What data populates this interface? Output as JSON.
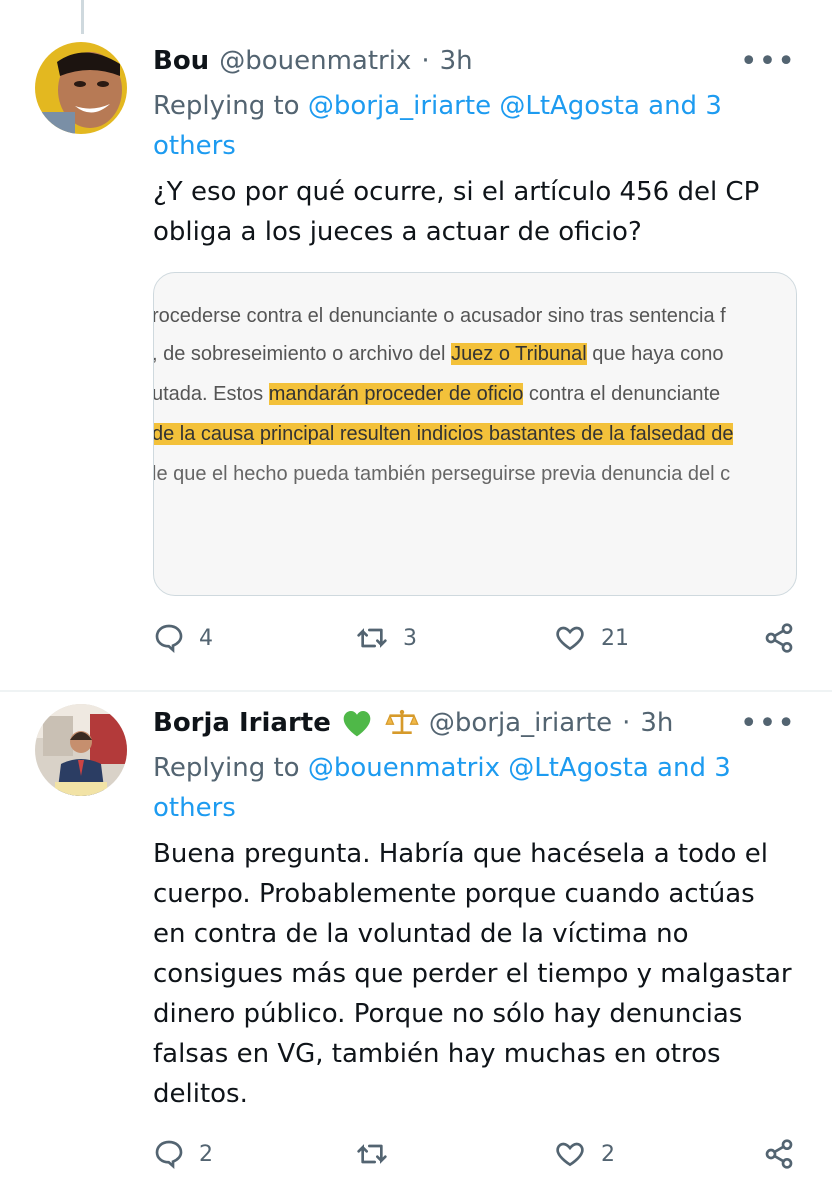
{
  "tweets": [
    {
      "name": "Bou",
      "handle": "@bouenmatrix",
      "time": "3h",
      "reply_prefix": "Replying to",
      "reply_mentions": "@borja_iriarte @LtAgosta and 3",
      "reply_mentions_2": "others",
      "text_lines": [
        "¿Y eso por qué ocurre, si el artículo 456 del CP",
        "obliga a los jueces a actuar de oficio?"
      ],
      "card": {
        "lines": [
          {
            "parts": [
              "rocederse contra el denunciante o acusador sino tras sentencia f"
            ]
          },
          {
            "parts": [
              ", de sobreseimiento o archivo del ",
              "Juez o Tribunal",
              " que haya cono"
            ]
          },
          {
            "parts": [
              "utada. Estos ",
              "mandarán proceder de oficio",
              " contra el denunciante"
            ]
          },
          {
            "parts": [
              "de la causa principal resulten indicios bastantes de la falsedad de"
            ]
          },
          {
            "parts": [
              "le que el hecho pueda también perseguirse previa denuncia del c"
            ]
          }
        ]
      },
      "stats": {
        "replies": "4",
        "retweets": "3",
        "likes": "21"
      }
    },
    {
      "name": "Borja Iriarte",
      "badge_icons": [
        "green-heart-icon",
        "scales-icon"
      ],
      "handle": "@borja_iriarte",
      "time": "3h",
      "reply_prefix": "Replying to",
      "reply_mentions": "@bouenmatrix @LtAgosta and 3",
      "reply_mentions_2": "others",
      "text_lines": [
        "Buena pregunta. Habría que hacésela a todo el",
        "cuerpo. Probablemente porque cuando actúas",
        "en contra de la voluntad de la víctima no",
        "consigues más que perder el tiempo y malgastar",
        "dinero público. Porque no sólo hay denuncias",
        "falsas en VG, también hay muchas en otros",
        "delitos."
      ],
      "stats": {
        "replies": "2",
        "retweets": "",
        "likes": "2"
      }
    }
  ],
  "separator": "·",
  "more_label": "•••",
  "colors": {
    "accent": "#1d9bf0",
    "secondary": "#536471",
    "highlight": "#f3c13a",
    "green_heart": "#4fb848"
  }
}
